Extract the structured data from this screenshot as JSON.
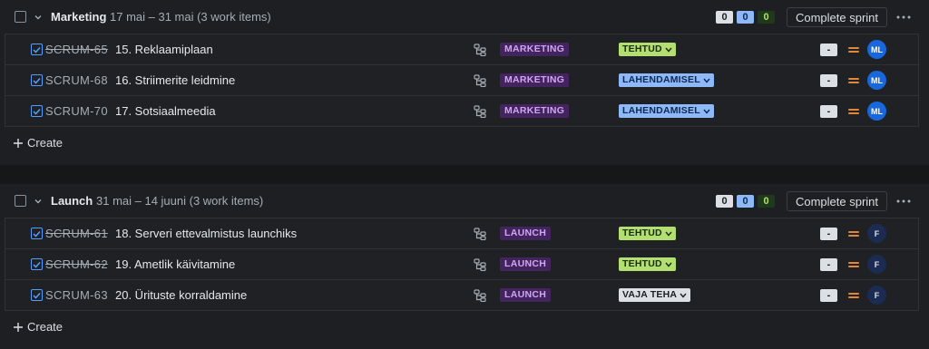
{
  "sprints": [
    {
      "name": "Marketing",
      "meta": "17 mai – 31 mai (3 work items)",
      "counts": {
        "todo": "0",
        "in_progress": "0",
        "done": "0"
      },
      "complete_label": "Complete sprint",
      "create_label": "Create",
      "items": [
        {
          "key": "SCRUM-65",
          "struck": true,
          "summary": "15. Reklaamiplaan",
          "label": "MARKETING",
          "status": "TEHTUD",
          "status_type": "done",
          "estimate": "-",
          "assignee": "ML"
        },
        {
          "key": "SCRUM-68",
          "struck": false,
          "summary": "16. Striimerite leidmine",
          "label": "MARKETING",
          "status": "LAHENDAMISEL",
          "status_type": "prog",
          "estimate": "-",
          "assignee": "ML"
        },
        {
          "key": "SCRUM-70",
          "struck": false,
          "summary": "17. Sotsiaalmeedia",
          "label": "MARKETING",
          "status": "LAHENDAMISEL",
          "status_type": "prog",
          "estimate": "-",
          "assignee": "ML"
        }
      ]
    },
    {
      "name": "Launch",
      "meta": "31 mai – 14 juuni (3 work items)",
      "counts": {
        "todo": "0",
        "in_progress": "0",
        "done": "0"
      },
      "complete_label": "Complete sprint",
      "create_label": "Create",
      "items": [
        {
          "key": "SCRUM-61",
          "struck": true,
          "summary": "18. Serveri ettevalmistus launchiks",
          "label": "LAUNCH",
          "status": "TEHTUD",
          "status_type": "done",
          "estimate": "-",
          "assignee": "F"
        },
        {
          "key": "SCRUM-62",
          "struck": true,
          "summary": "19. Ametlik käivitamine",
          "label": "LAUNCH",
          "status": "TEHTUD",
          "status_type": "done",
          "estimate": "-",
          "assignee": "F"
        },
        {
          "key": "SCRUM-63",
          "struck": false,
          "summary": "20. Ürituste korraldamine",
          "label": "LAUNCH",
          "status": "VAJA TEHA",
          "status_type": "todo",
          "estimate": "-",
          "assignee": "F"
        }
      ]
    }
  ],
  "colors": {
    "background": "#161719",
    "panel": "#1d1f22",
    "label_bg": "#44245e",
    "label_fg": "#cfa6f2",
    "status_done": "#b3df72",
    "status_progress": "#8fb8f6",
    "status_todo": "#dcdfe4",
    "priority_medium": "#e2873a",
    "avatar_ml": "#1868db",
    "avatar_f": "#1c2b52"
  },
  "icons": {
    "row_checkbox": "checkbox-checked-icon",
    "hierarchy": "child-items-icon",
    "priority": "priority-medium-icon",
    "chevron": "chevron-down-icon",
    "more": "more-horizontal-icon",
    "plus": "plus-icon"
  }
}
